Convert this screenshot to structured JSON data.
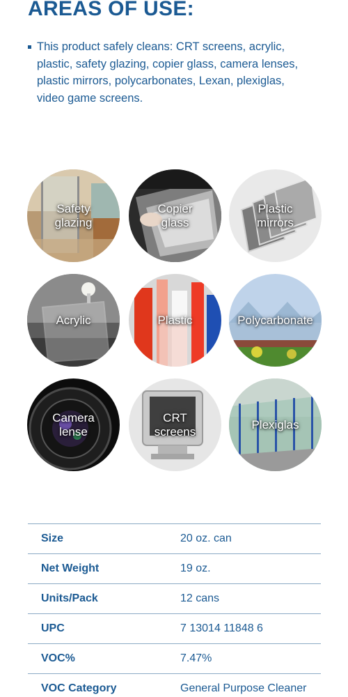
{
  "heading": "AREAS OF USE:",
  "uses_text": "This product safely cleans: CRT screens, acrylic, plastic, safety glazing, copier glass, camera lenses, plastic mirrors, polycarbonates, Lexan, plexiglas, video game screens.",
  "tiles": [
    {
      "label": "Safety\nglazing",
      "icon": "shower-glass-image"
    },
    {
      "label": "Copier\nglass",
      "icon": "copier-image"
    },
    {
      "label": "Plastic\nmirrors",
      "icon": "plastic-sheets-image"
    },
    {
      "label": "Acrylic",
      "icon": "acrylic-table-image"
    },
    {
      "label": "Plastic",
      "icon": "plastic-tubes-image"
    },
    {
      "label": "Polycarbonate",
      "icon": "greenhouse-image"
    },
    {
      "label": "Camera\nlense",
      "icon": "camera-lens-image"
    },
    {
      "label": "CRT\nscreens",
      "icon": "crt-monitor-image"
    },
    {
      "label": "Plexiglas",
      "icon": "plexiglas-barrier-image"
    }
  ],
  "specs": [
    {
      "key": "Size",
      "value": "20 oz. can"
    },
    {
      "key": "Net Weight",
      "value": "19 oz."
    },
    {
      "key": "Units/Pack",
      "value": "12 cans"
    },
    {
      "key": "UPC",
      "value": "7 13014 11848 6"
    },
    {
      "key": "VOC%",
      "value": "7.47%"
    },
    {
      "key": "VOC Category",
      "value": "General Purpose Cleaner"
    }
  ],
  "colors": {
    "brand_blue": "#1b5a93",
    "rule": "#8aa9c4"
  }
}
